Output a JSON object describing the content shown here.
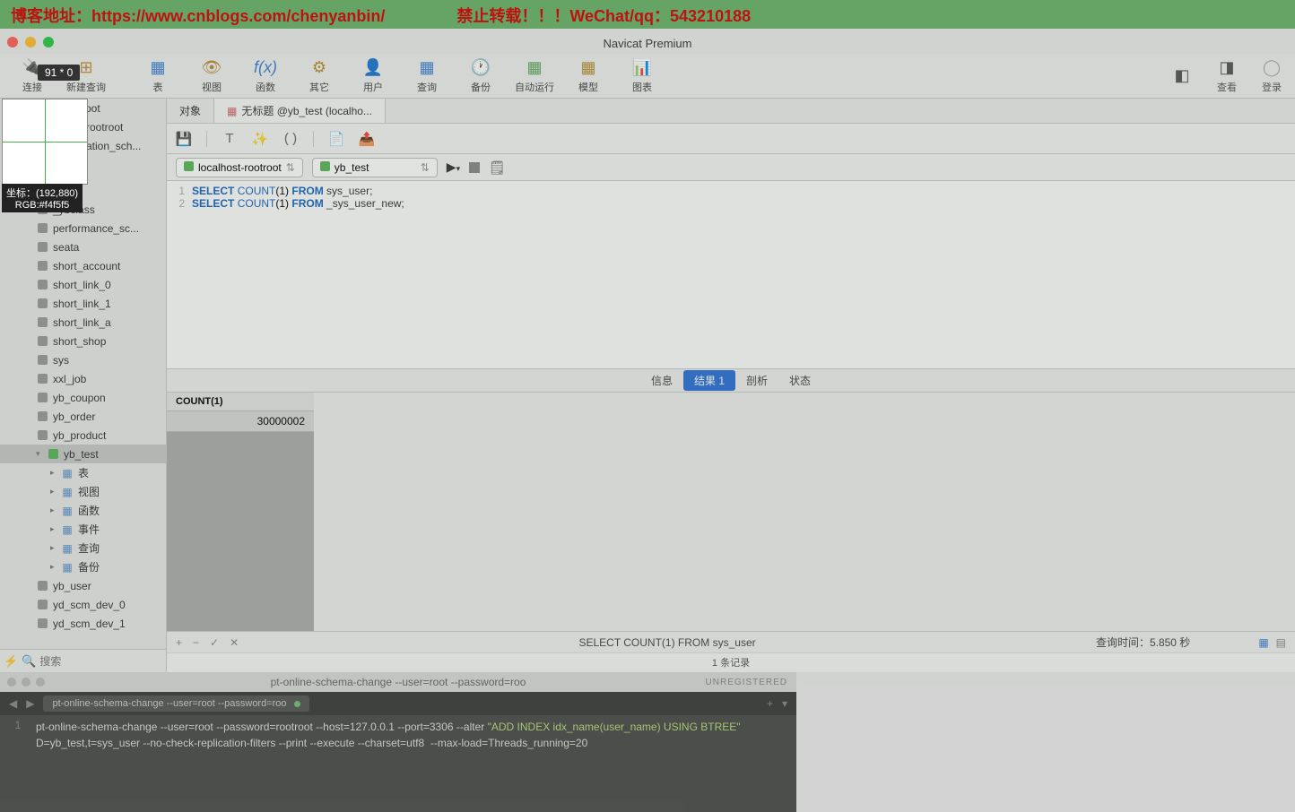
{
  "watermark": {
    "blog": "博客地址：https://www.cnblogs.com/chenyanbin/",
    "warn": "禁止转载！！！WeChat/qq：543210188"
  },
  "window": {
    "title": "Navicat Premium"
  },
  "pixel_badge": "91 * 0",
  "magnifier": {
    "coord": "坐标：(192,880)",
    "rgb": "RGB:#f4f5f5"
  },
  "toolbar": [
    {
      "label": "连接",
      "color": "#555"
    },
    {
      "label": "新建查询",
      "color": "#555"
    },
    {
      "label": "表",
      "color": "#3b7fd4"
    },
    {
      "label": "视图",
      "color": "#b88c2f"
    },
    {
      "label": "函数",
      "color": "#3b7fd4"
    },
    {
      "label": "其它",
      "color": "#b88c2f"
    },
    {
      "label": "用户",
      "color": "#c68b3a"
    },
    {
      "label": "查询",
      "color": "#3b7fd4"
    },
    {
      "label": "备份",
      "color": "#777"
    },
    {
      "label": "自动运行",
      "color": "#5aa65a"
    },
    {
      "label": "模型",
      "color": "#b88c2f"
    },
    {
      "label": "图表",
      "color": "#7aa9d8"
    }
  ],
  "toolbar_right": {
    "view": "查看",
    "login": "登录"
  },
  "sidebar": {
    "root": "docker-root",
    "partial1": "rootroot",
    "partial2": "ation_sch...",
    "items": [
      "_ybclass",
      "performance_sc...",
      "seata",
      "short_account",
      "short_link_0",
      "short_link_1",
      "short_link_a",
      "short_shop",
      "sys",
      "xxl_job",
      "yb_coupon",
      "yb_order",
      "yb_product"
    ],
    "selected": "yb_test",
    "sub": [
      {
        "label": "表"
      },
      {
        "label": "视图"
      },
      {
        "label": "函数"
      },
      {
        "label": "事件"
      },
      {
        "label": "查询"
      },
      {
        "label": "备份"
      }
    ],
    "after": [
      "yb_user",
      "yd_scm_dev_0",
      "yd_scm_dev_1"
    ],
    "search_placeholder": "搜索"
  },
  "tabs": {
    "t1": "对象",
    "t2": "无标题 @yb_test (localho..."
  },
  "conn": {
    "host": "localhost-rootroot",
    "db": "yb_test"
  },
  "sql": {
    "line1": {
      "n": "1",
      "sel": "SELECT",
      "cnt": "COUNT",
      "arg": "(1)",
      "from": "FROM",
      "tbl": "sys_user;"
    },
    "line2": {
      "n": "2",
      "sel": "SELECT",
      "cnt": "COUNT",
      "arg": "(1)",
      "from": "FROM",
      "tbl": "_sys_user_new;"
    }
  },
  "result_tabs": {
    "info": "信息",
    "res1": "结果 1",
    "profile": "剖析",
    "status": "状态"
  },
  "result": {
    "header": "COUNT(1)",
    "value": "30000002"
  },
  "status": {
    "query": "SELECT COUNT(1) FROM sys_user",
    "time": "查询时间：5.850 秒",
    "records": "1 条记录"
  },
  "terminal": {
    "title": "pt-online-schema-change --user=root --password=roo",
    "unreg": "UNREGISTERED",
    "tab": "pt-online-schema-change --user=root --password=roo",
    "line_no": "1",
    "code_pre": "pt-online-schema-change --user=root --password=rootroot --host=127.0.0.1 --port=3306 --alter ",
    "code_str": "\"ADD INDEX idx_name(user_name) USING BTREE\"",
    "code_post": " D=yb_test,t=sys_user --no-check-replication-filters --print --execute --charset=utf8  --max-load=Threads_running=20"
  }
}
